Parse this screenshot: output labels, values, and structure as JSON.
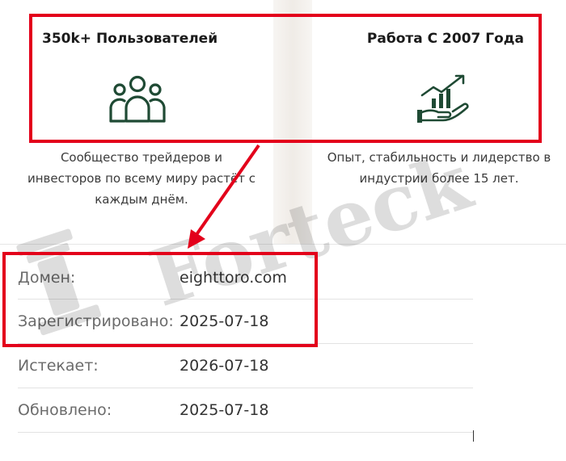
{
  "features": [
    {
      "title": "350k+ Пользователей",
      "icon": "users-group-icon",
      "description": "Сообщество трейдеров и инвесторов по всему миру растёт с каждым днём."
    },
    {
      "title": "Работа С 2007 Года",
      "icon": "growth-chart-hand-icon",
      "description": "Опыт, стабильность и лидерство в индустрии более 15 лет."
    }
  ],
  "whois": {
    "rows": [
      {
        "label": "Домен:",
        "value": "eighttoro.com"
      },
      {
        "label": "Зарегистрировано:",
        "value": "2025-07-18"
      },
      {
        "label": "Истекает:",
        "value": "2026-07-18"
      },
      {
        "label": "Обновлено:",
        "value": "2025-07-18"
      }
    ]
  },
  "watermark": {
    "text": "Forteck"
  },
  "colors": {
    "highlight": "#e3001b",
    "icon_green": "#1f4a34",
    "label_gray": "#6b6b6b"
  }
}
